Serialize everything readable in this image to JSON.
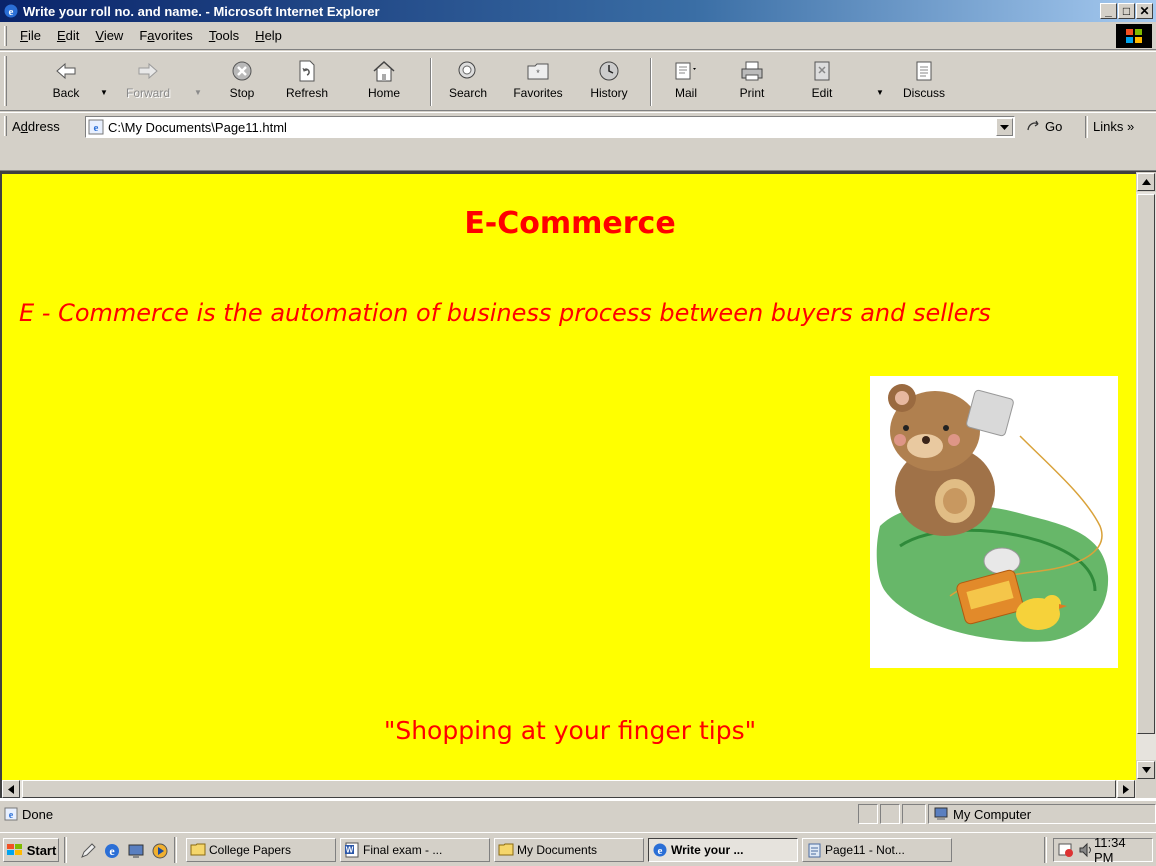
{
  "window": {
    "title": "Write your roll no. and name. - Microsoft Internet Explorer",
    "minimize": "_",
    "maximize": "□",
    "close": "✕"
  },
  "menu": {
    "items": [
      {
        "pre": "",
        "key": "F",
        "post": "ile"
      },
      {
        "pre": "",
        "key": "E",
        "post": "dit"
      },
      {
        "pre": "",
        "key": "V",
        "post": "iew"
      },
      {
        "pre": "F",
        "key": "a",
        "post": "vorites"
      },
      {
        "pre": "",
        "key": "T",
        "post": "ools"
      },
      {
        "pre": "",
        "key": "H",
        "post": "elp"
      }
    ]
  },
  "toolbar": {
    "back": "Back",
    "forward": "Forward",
    "stop": "Stop",
    "refresh": "Refresh",
    "home": "Home",
    "search": "Search",
    "favorites": "Favorites",
    "history": "History",
    "mail": "Mail",
    "print": "Print",
    "edit": "Edit",
    "discuss": "Discuss"
  },
  "address": {
    "label_pre": "A",
    "label_key": "d",
    "label_post": "dress",
    "url": "C:\\My Documents\\Page11.html",
    "go": "Go",
    "links": "Links »"
  },
  "page": {
    "background_color": "#ffff00",
    "text_color": "#ff0000",
    "heading": "E-Commerce",
    "lead": "E - Commerce is the automation of business process between buyers and sellers",
    "tagline": "\"Shopping at your finger tips\""
  },
  "status": {
    "text": "Done",
    "zone": "My Computer"
  },
  "taskbar": {
    "start": "Start",
    "tasks": [
      {
        "label": "College Papers",
        "icon": "folder-icon"
      },
      {
        "label": "Final exam - ...",
        "icon": "word-doc-icon"
      },
      {
        "label": "My Documents",
        "icon": "folder-icon"
      },
      {
        "label": "Write your ...",
        "icon": "ie-icon",
        "active": true
      },
      {
        "label": "Page11 - Not...",
        "icon": "notepad-icon"
      }
    ],
    "clock": "11:34 PM"
  }
}
